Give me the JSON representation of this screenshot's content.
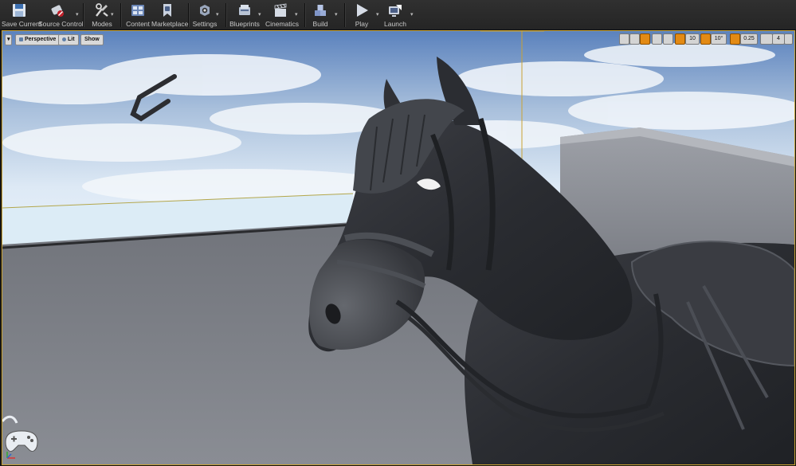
{
  "toolbar": {
    "save_current": "Save Current",
    "source_control": "Source Control",
    "modes": "Modes",
    "content": "Content",
    "marketplace": "Marketplace",
    "settings": "Settings",
    "blueprints": "Blueprints",
    "cinematics": "Cinematics",
    "build": "Build",
    "play": "Play",
    "launch": "Launch"
  },
  "viewport": {
    "perspective_label": "Perspective",
    "lit_label": "Lit",
    "show_label": "Show",
    "grid_snap_value": "10",
    "rotation_snap_value": "10°",
    "scale_snap_value": "0.25",
    "camera_speed_value": "4"
  },
  "colors": {
    "selection_outline": "#c9a233",
    "accent_orange": "#e38a14"
  }
}
